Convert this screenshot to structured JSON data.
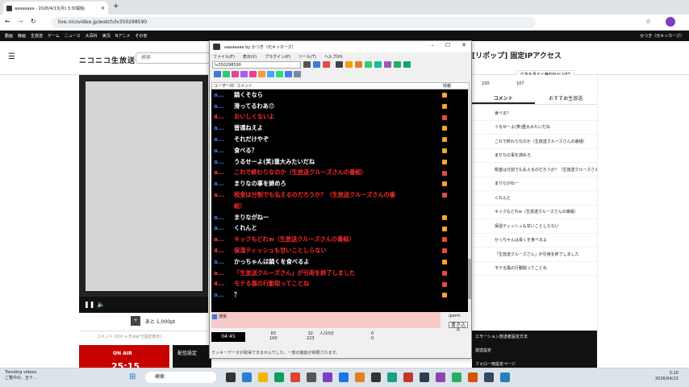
{
  "browser": {
    "tab_title": "aaaaaaaa - 2026/4/13(月) 3:30開始",
    "new_tab": "+",
    "url": "live.nicovideo.jp/watch/lv350298590",
    "bookmarks": [
      "動画",
      "静画",
      "生放送",
      "ゲーム",
      "ニュース",
      "大百科",
      "実況",
      "Nアニメ",
      "その他"
    ],
    "user": "かつき（元キッカーズ）"
  },
  "page": {
    "logo": "ニコニコ生放送",
    "search_placeholder": "検索",
    "title_right": "[リポップ] 固定IPアクセス",
    "ad_label": "広告を見ると無料Ptが GET",
    "right_counts": [
      "230",
      "107"
    ],
    "tabs": [
      "コメント",
      "おすすめ生放送"
    ],
    "right_comments": [
      "食べる？",
      "うるせーよ(笑)重大みたいだね",
      "これで終わりなのか（生放送クルーズさんの番組）",
      "まりなの事を諦めろ",
      "税金は分割でも払えるのだろうか？（生放送クルーズさん",
      "まりながねー",
      "くれんと",
      "キックもどれw（生放送クルーズさんの番組）",
      "保湿ティッシュも甘いことしらない",
      "かっちゃんは長くを食べるよ",
      "「生放送クルーズさん」が引用を終了しました",
      "モテる風の行動取ってことね"
    ],
    "below_video": "あと 1,000pt",
    "comment_input_placeholder": "コメント (Ctrl + Enterで固定表示)",
    "on_air": "ON AIR",
    "on_air_number": "25:15",
    "haishin": "配信設定",
    "right_bottom": [
      "エモーション放送者設定方法",
      "放送設定",
      "フォロー用設定ページ"
    ]
  },
  "app": {
    "window_title": "aaaaaaaa by かつき（元キッカーズ）",
    "menu": [
      "ファイル(F)",
      "表示(V)",
      "プラグイン(P)",
      "ツール(T)",
      "ヘルプ(H)"
    ],
    "live_id": "lv350298590",
    "col_user": "ユーザーID",
    "col_comment": "コメント",
    "col_source": "情報",
    "comments": [
      {
        "user": "a...",
        "text": "鍋くそなら",
        "red": false
      },
      {
        "user": "a...",
        "text": "滑ってるわあ😠",
        "red": false
      },
      {
        "user": "4...",
        "text": "おいしくないよ",
        "red": true
      },
      {
        "user": "a...",
        "text": "普通ねえよ",
        "red": false
      },
      {
        "user": "a...",
        "text": "それだけやぞ",
        "red": false
      },
      {
        "user": "a...",
        "text": "食べる？",
        "red": false
      },
      {
        "user": "a...",
        "text": "うるせーよ(笑)重大みたいだね",
        "red": false
      },
      {
        "user": "a...",
        "text": "これで終わりなのか（生放送クルーズさんの番組）",
        "red": true
      },
      {
        "user": "a...",
        "text": "まりなの事を諦めろ",
        "red": false
      },
      {
        "user": "a...",
        "text": "税金は分割でも払えるのだろうか？（生放送クルーズさんの番",
        "red": true
      },
      {
        "user": "",
        "text": "組）",
        "red": true
      },
      {
        "user": "a...",
        "text": "まりながねー",
        "red": false
      },
      {
        "user": "a...",
        "text": "くれんと",
        "red": false
      },
      {
        "user": "a...",
        "text": "キックもどれw（生放送クルーズさんの番組）",
        "red": true
      },
      {
        "user": "4...",
        "text": "保湿ティッシュも甘いことしらない",
        "red": true
      },
      {
        "user": "a...",
        "text": "かっちゃんは鍋くを食べるよ",
        "red": false
      },
      {
        "user": "a...",
        "text": "「生放送クルーズさん」が引用を終了しました",
        "red": true
      },
      {
        "user": "4...",
        "text": "モテる風の行動取ってことね",
        "red": true
      },
      {
        "user": "a...",
        "text": "？",
        "red": false
      }
    ],
    "input_label": "通常",
    "perm_label": "/perm",
    "send_button": "書き込み",
    "time": "04:45",
    "stats": [
      {
        "a": "83",
        "b": "100"
      },
      {
        "a": "32",
        "b": "223"
      },
      {
        "a": "人/10分",
        "b": ""
      },
      {
        "a": "0",
        "b": "0"
      }
    ],
    "status": "クッキーデータが取得できませんでした。一部の機能が制限されます。"
  },
  "taskbar": {
    "news_title": "Trending videos",
    "news_sub": "ご覧中の、五十...",
    "search": "検索",
    "time": "3:10",
    "date": "2026/04/13"
  }
}
